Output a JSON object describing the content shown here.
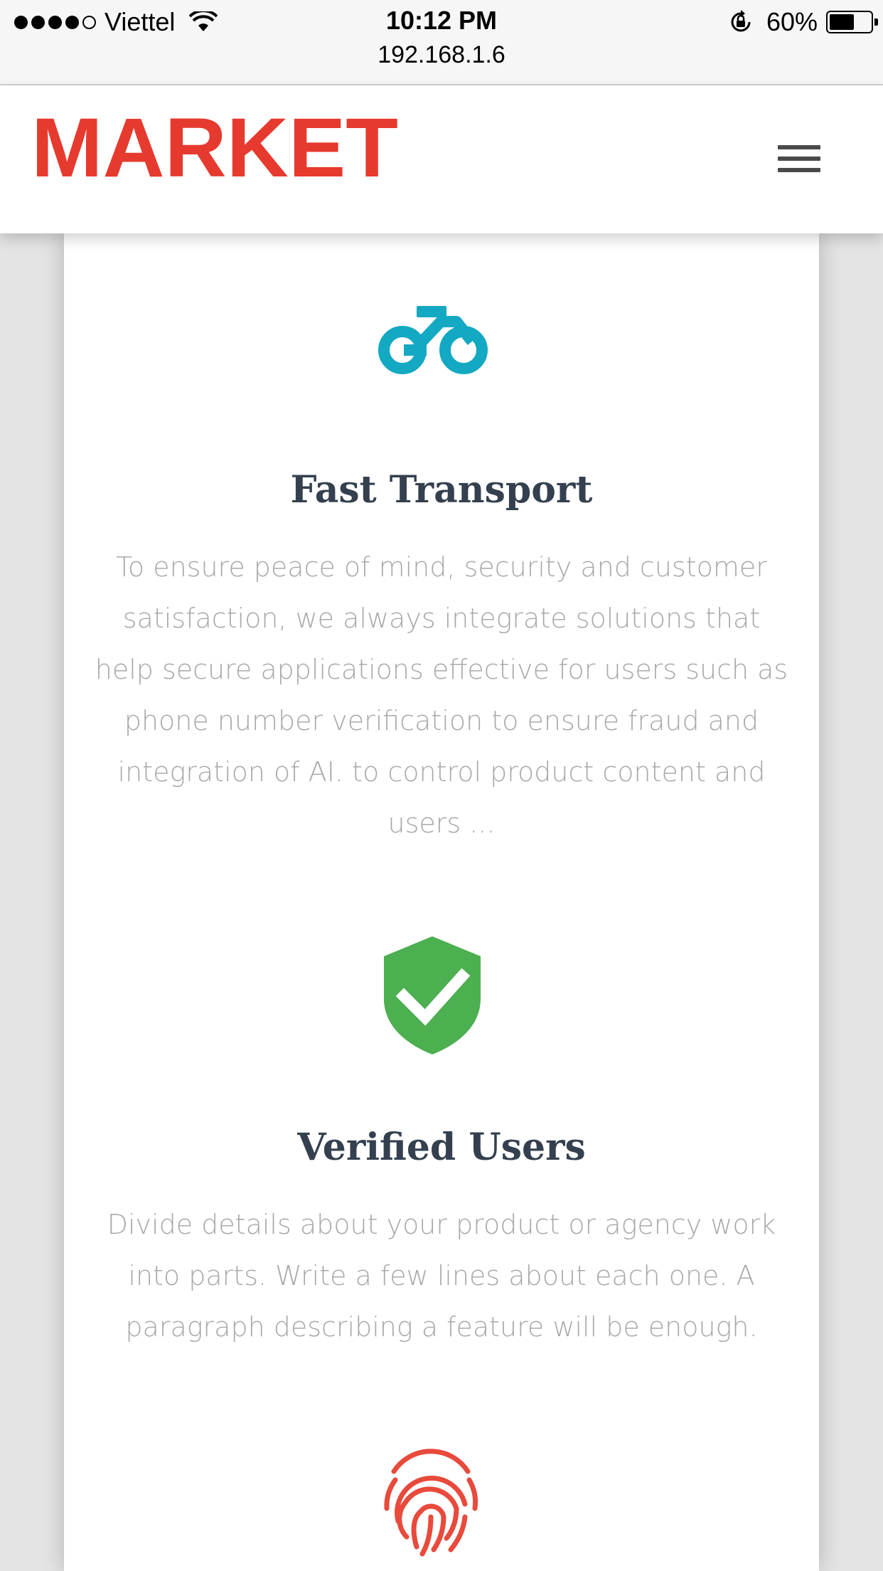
{
  "status_bar": {
    "carrier": "Viettel",
    "time": "10:12 PM",
    "url": "192.168.1.6",
    "battery": "60%",
    "battery_level": 0.6
  },
  "header": {
    "logo_text": "MARKET",
    "logo_color": "#e63a2e",
    "menu_icon": "hamburger-icon"
  },
  "features": [
    {
      "icon": "motorbike-icon",
      "icon_color": "#14a9c3",
      "title": "Fast Transport",
      "description": "To ensure peace of mind, security and customer satisfaction, we always integrate solutions that help secure applications effective for users such as phone number verification to ensure fraud and integration of AI. to control product content and users ..."
    },
    {
      "icon": "shield-check-icon",
      "icon_color": "#4caf50",
      "title": "Verified Users",
      "description": "Divide details about your product or agency work into parts. Write a few lines about each one. A paragraph describing a feature will be enough."
    },
    {
      "icon": "fingerprint-icon",
      "icon_color": "#e84a3c"
    }
  ]
}
